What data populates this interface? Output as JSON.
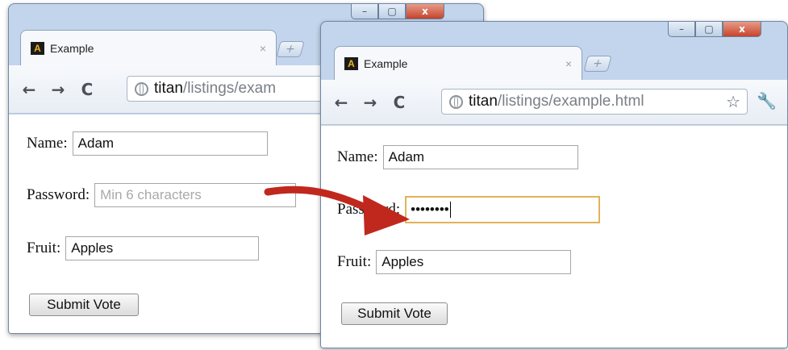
{
  "window_before": {
    "tab_title": "Example",
    "tab_close": "×",
    "new_tab": "+",
    "url_host": "titan",
    "url_path": "/listings/exam",
    "form": {
      "name_label": "Name:",
      "name_value": "Adam",
      "password_label": "Password:",
      "password_placeholder": "Min 6 characters",
      "fruit_label": "Fruit:",
      "fruit_value": "Apples",
      "submit_label": "Submit Vote"
    }
  },
  "window_after": {
    "tab_title": "Example",
    "tab_close": "×",
    "new_tab": "+",
    "url_host": "titan",
    "url_path": "/listings/example.html",
    "form": {
      "name_label": "Name:",
      "name_value": "Adam",
      "password_label": "Password:",
      "password_value": "••••••••",
      "fruit_label": "Fruit:",
      "fruit_value": "Apples",
      "submit_label": "Submit Vote"
    }
  },
  "icons": {
    "back": "←",
    "forward": "→",
    "reload": "C",
    "star": "☆",
    "wrench": "🔧",
    "minimize": "–",
    "maximize": "▢",
    "close": "x",
    "favicon_letter": "A"
  },
  "colors": {
    "frame": "#c3d5ec",
    "focus_border": "#e3b25a",
    "arrow": "#c0281e"
  }
}
